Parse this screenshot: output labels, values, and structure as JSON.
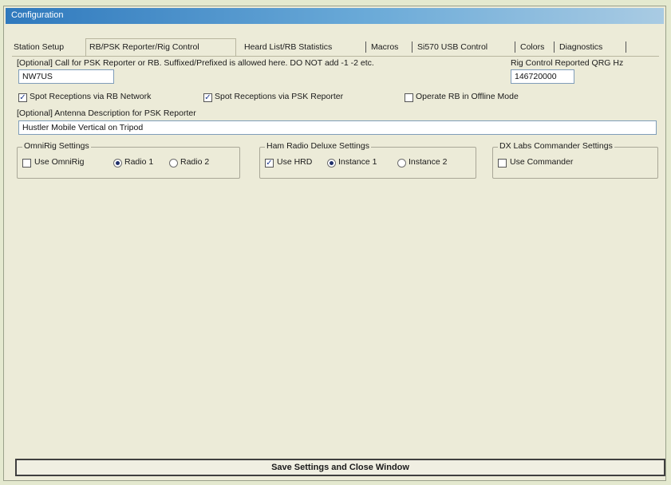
{
  "window": {
    "title": "Configuration"
  },
  "tabs": [
    {
      "label": "Station Setup",
      "selected": false
    },
    {
      "label": "RB/PSK Reporter/Rig Control",
      "selected": true
    },
    {
      "label": "Heard List/RB Statistics",
      "selected": false
    },
    {
      "label": "Macros",
      "selected": false
    },
    {
      "label": "Si570 USB Control",
      "selected": false
    },
    {
      "label": "Colors",
      "selected": false
    },
    {
      "label": "Diagnostics",
      "selected": false
    }
  ],
  "call": {
    "label": "[Optional] Call for PSK Reporter or RB.  Suffixed/Prefixed is allowed here.  DO NOT add -1 -2 etc.",
    "value": "NW7US"
  },
  "rig_qrg": {
    "label": "Rig Control Reported QRG Hz",
    "value": "146720000"
  },
  "options": [
    {
      "label": "Spot Receptions via RB Network",
      "checked": true
    },
    {
      "label": "Spot Receptions via PSK Reporter",
      "checked": true
    },
    {
      "label": "Operate RB in Offline Mode",
      "checked": false
    }
  ],
  "antenna": {
    "label": "[Optional] Antenna Description for PSK Reporter",
    "value": "Hustler Mobile Vertical on Tripod"
  },
  "omnirig": {
    "title": "OmniRig Settings",
    "use_label": "Use OmniRig",
    "use_checked": false,
    "radio1_label": "Radio 1",
    "radio2_label": "Radio 2",
    "selected": "Radio 1"
  },
  "hrd": {
    "title": "Ham Radio Deluxe Settings",
    "use_label": "Use HRD",
    "use_checked": true,
    "inst1_label": "Instance 1",
    "inst2_label": "Instance 2",
    "selected": "Instance 1"
  },
  "dxlabs": {
    "title": "DX Labs Commander Settings",
    "use_label": "Use Commander",
    "use_checked": false
  },
  "save_button": {
    "label": "Save Settings and Close Window"
  },
  "check_glyph": "✓",
  "colors": {
    "title_bar": "#2f79bd",
    "background": "#ecebd8",
    "outer": "#e4e9cf"
  }
}
